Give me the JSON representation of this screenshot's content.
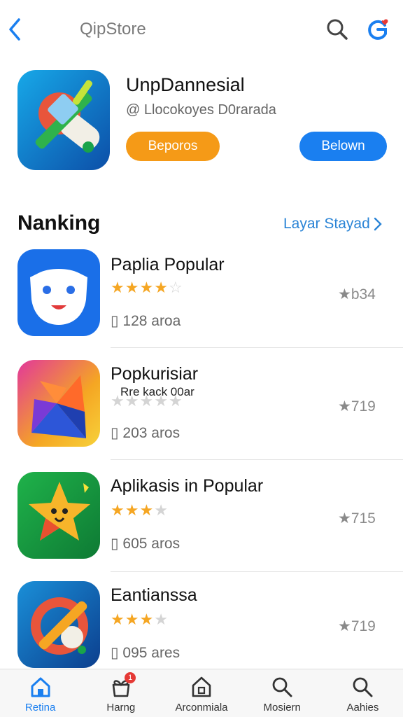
{
  "header": {
    "title": "QipStore",
    "back_icon": "chevron-left-icon",
    "search_icon": "search-icon",
    "profile_icon": "profile-icon"
  },
  "featured": {
    "title": "UnpDannesial",
    "subtitle": "@ Llocokoyes D0rarada",
    "primary_button": "Beporos",
    "secondary_button": "Belown",
    "icon": "tools-icon"
  },
  "section": {
    "title": "Nanking",
    "see_all": "Layar Stayad"
  },
  "apps": [
    {
      "title": "Paplia Popular",
      "subtitle": "",
      "stars": 4.5,
      "rating": "★b34",
      "size": "▯ 128 aroa",
      "icon": "smiley-face-icon"
    },
    {
      "title": "Popkurisiar",
      "subtitle": "Rre kack 00ar",
      "stars": 0,
      "rating": "★719",
      "size": "▯ 203 aros",
      "icon": "origami-bird-icon"
    },
    {
      "title": "Aplikasis in Popular",
      "subtitle": "",
      "stars": 3,
      "rating": "★715",
      "size": "▯ 605 aros",
      "icon": "star-character-icon"
    },
    {
      "title": "Eantianssa",
      "subtitle": "",
      "stars": 3,
      "rating": "★719",
      "size": "▯ 095 ares",
      "icon": "circle-slash-icon"
    }
  ],
  "tabs": [
    {
      "label": "Retina",
      "icon": "home-icon",
      "active": true
    },
    {
      "label": "Harng",
      "icon": "gift-icon",
      "active": false,
      "badge": "1"
    },
    {
      "label": "Arconmiala",
      "icon": "store-icon",
      "active": false
    },
    {
      "label": "Mosiern",
      "icon": "search-icon",
      "active": false
    },
    {
      "label": "Aahies",
      "icon": "search-icon",
      "active": false
    }
  ],
  "colors": {
    "accent_blue": "#1a7ff0",
    "accent_orange": "#f59a17",
    "star": "#f5a623",
    "link": "#2a84d6"
  }
}
